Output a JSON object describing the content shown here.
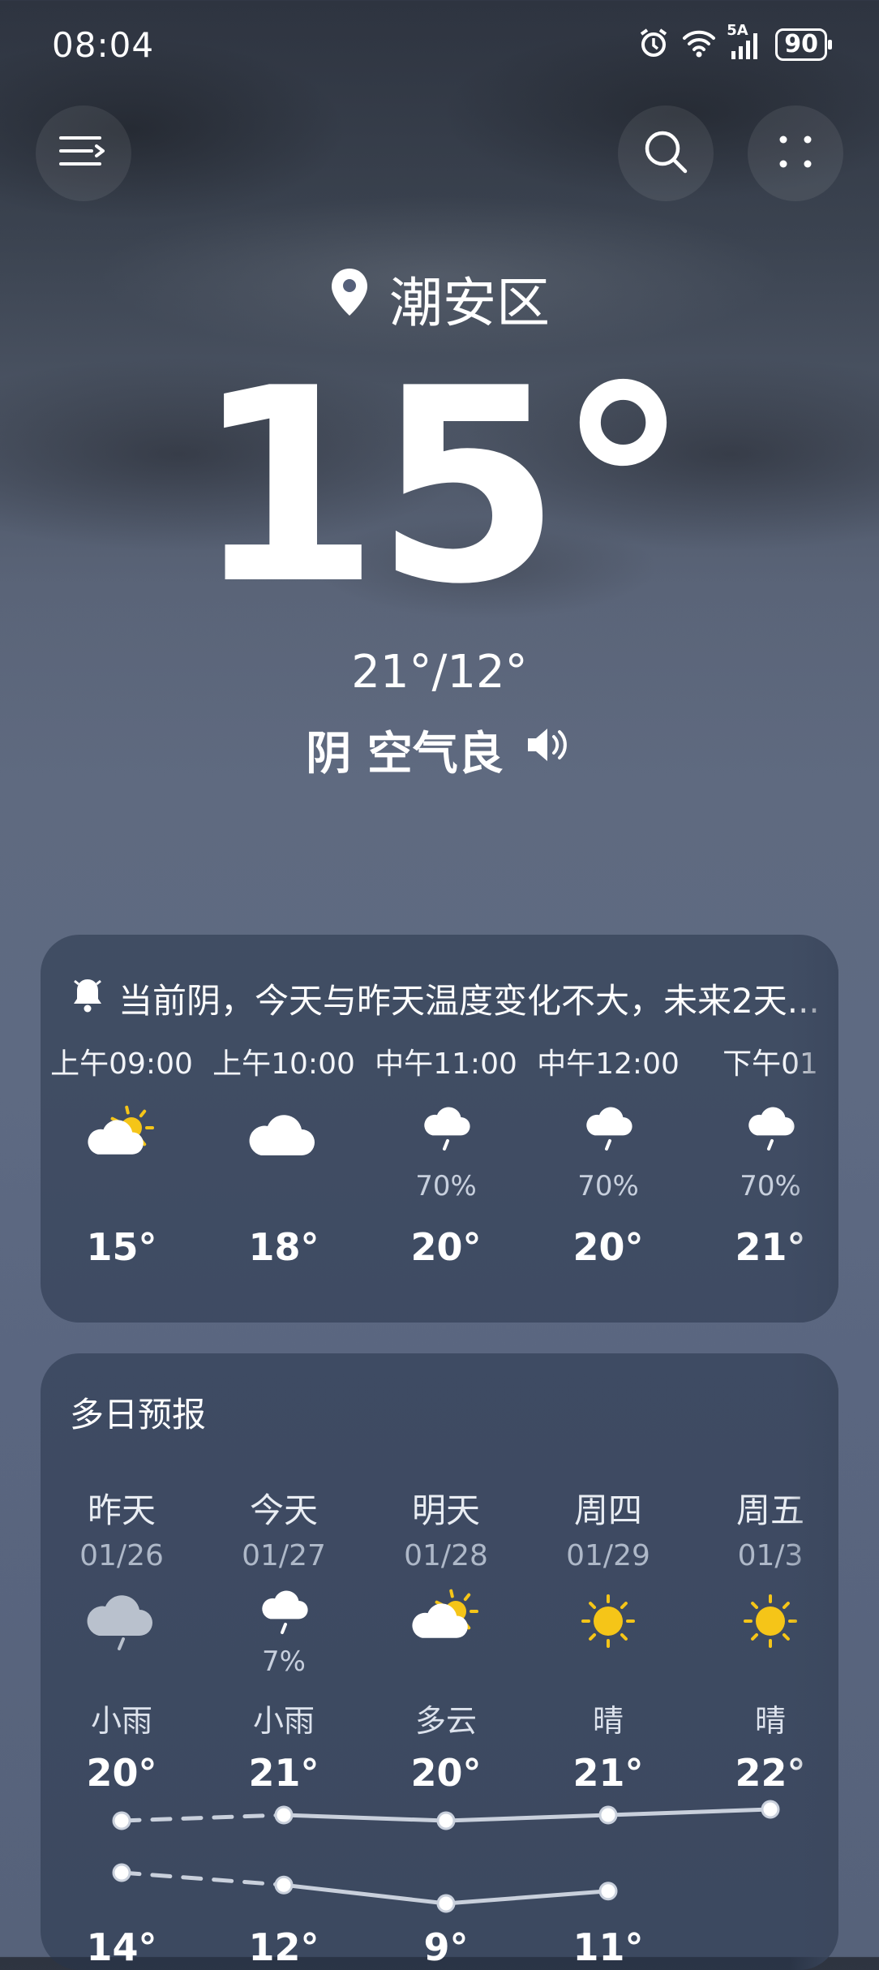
{
  "status": {
    "time": "08:04",
    "network": "5A",
    "battery": "90"
  },
  "location": {
    "name": "潮安区"
  },
  "current": {
    "temp": "15°",
    "range": "21°/12°",
    "condition": "阴 空气良"
  },
  "hourly": {
    "alert": "当前阴，今天与昨天温度变化不大，未来2天...",
    "items": [
      {
        "time": "上午09:00",
        "icon": "partly-cloudy-icon",
        "precip": "",
        "temp": "15°"
      },
      {
        "time": "上午10:00",
        "icon": "cloud-icon",
        "precip": "",
        "temp": "18°"
      },
      {
        "time": "中午11:00",
        "icon": "light-rain-icon",
        "precip": "70%",
        "temp": "20°"
      },
      {
        "time": "中午12:00",
        "icon": "light-rain-icon",
        "precip": "70%",
        "temp": "20°"
      },
      {
        "time": "下午01",
        "icon": "light-rain-icon",
        "precip": "70%",
        "temp": "21°"
      }
    ]
  },
  "daily": {
    "title": "多日预报",
    "items": [
      {
        "day": "昨天",
        "date": "01/26",
        "icon": "rain-cloud-icon",
        "precip": "",
        "weather": "小雨",
        "high": "20°",
        "low": "14°"
      },
      {
        "day": "今天",
        "date": "01/27",
        "icon": "light-rain-icon",
        "precip": "7%",
        "weather": "小雨",
        "high": "21°",
        "low": "12°"
      },
      {
        "day": "明天",
        "date": "01/28",
        "icon": "partly-cloudy-icon",
        "precip": "",
        "weather": "多云",
        "high": "20°",
        "low": "9°"
      },
      {
        "day": "周四",
        "date": "01/29",
        "icon": "sun-icon",
        "precip": "",
        "weather": "晴",
        "high": "21°",
        "low": "11°"
      },
      {
        "day": "周五",
        "date": "01/3",
        "icon": "sun-icon",
        "precip": "",
        "weather": "晴",
        "high": "22°",
        "low": ""
      }
    ]
  },
  "colors": {
    "sun": "#f5c518",
    "cloud": "#ffffff",
    "cloud_grey": "#b9c1cd"
  }
}
